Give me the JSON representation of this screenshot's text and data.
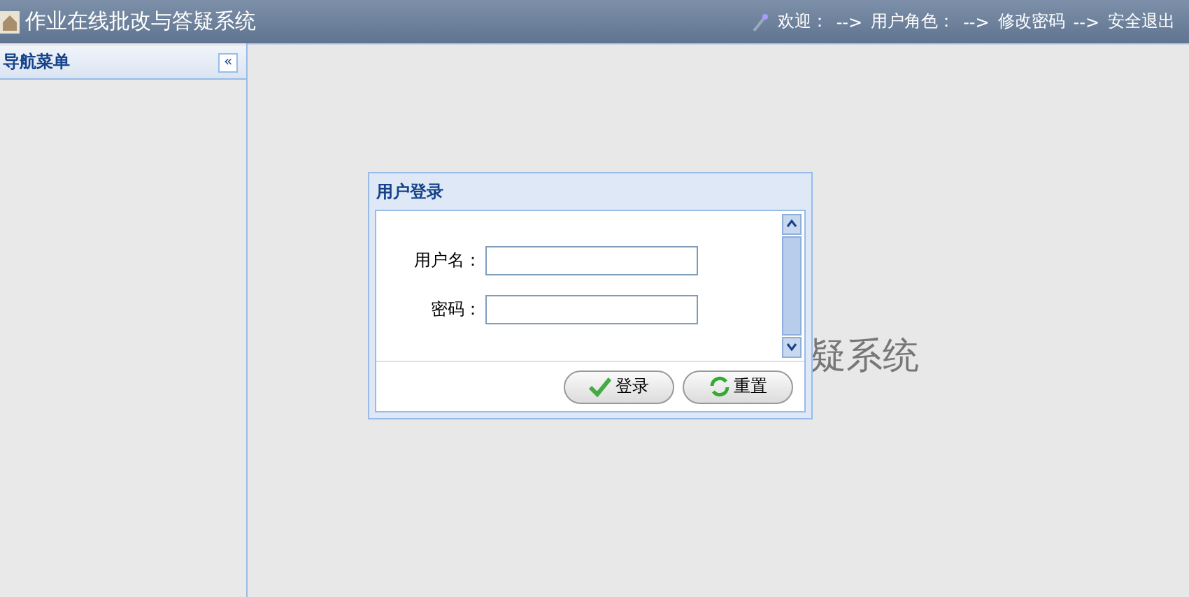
{
  "header": {
    "title": "作业在线批改与答疑系统",
    "links": [
      "欢迎：",
      "-->",
      "用户角色：",
      "-->",
      "修改密码",
      "-->",
      "安全退出"
    ]
  },
  "sidebar": {
    "title": "导航菜单",
    "collapse": "«"
  },
  "main": {
    "background_text": "疑系统"
  },
  "dialog": {
    "title": "用户登录",
    "fields": [
      {
        "label": "用户名："
      },
      {
        "label": "密码："
      }
    ],
    "buttons": [
      {
        "label": "登录",
        "kind": "check"
      },
      {
        "label": "重置",
        "kind": "refresh"
      }
    ]
  }
}
